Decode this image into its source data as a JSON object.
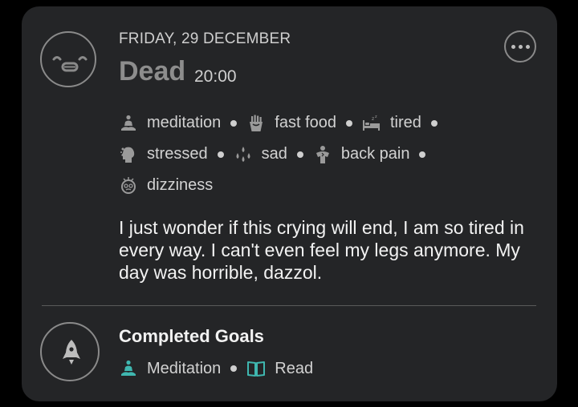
{
  "entry": {
    "date": "FRIDAY, 29 DECEMBER",
    "mood": "Dead",
    "time": "20:00",
    "mood_icon": "dead-face-icon",
    "menu_icon": "more-options-icon",
    "activities": [
      {
        "label": "meditation",
        "icon": "meditation-icon"
      },
      {
        "label": "fast food",
        "icon": "fries-icon"
      },
      {
        "label": "tired",
        "icon": "bed-icon"
      },
      {
        "label": "stressed",
        "icon": "stress-head-icon"
      },
      {
        "label": "sad",
        "icon": "tears-icon"
      },
      {
        "label": "back pain",
        "icon": "back-pain-icon"
      },
      {
        "label": "dizziness",
        "icon": "dizzy-face-icon"
      }
    ],
    "note": "I just wonder if this crying will end, I am so tired in every way. I can't even feel my legs anymore. My day was horrible, dazzol."
  },
  "goals": {
    "title": "Completed Goals",
    "icon": "rocket-icon",
    "accent_color": "#3fb7b0",
    "items": [
      {
        "label": "Meditation",
        "icon": "meditation-icon"
      },
      {
        "label": "Read",
        "icon": "book-icon"
      }
    ]
  },
  "colors": {
    "background": "#000000",
    "card": "#242527",
    "mood_text": "#8d8d8d",
    "text": "#f2f2f2",
    "accent": "#3fb7b0"
  }
}
